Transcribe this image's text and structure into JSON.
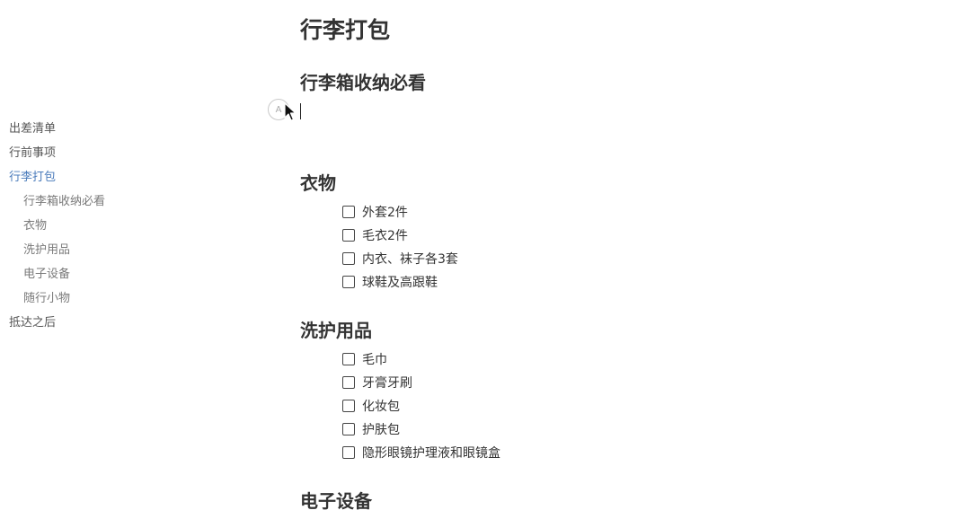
{
  "outline": {
    "items": [
      {
        "label": "出差清单"
      },
      {
        "label": "行前事项"
      },
      {
        "label": "行李打包"
      },
      {
        "label": "行李箱收纳必看"
      },
      {
        "label": "衣物"
      },
      {
        "label": "洗护用品"
      },
      {
        "label": "电子设备"
      },
      {
        "label": "随行小物"
      },
      {
        "label": "抵达之后"
      }
    ],
    "active_color": "#4a7bbb"
  },
  "editor": {
    "title": "行李打包",
    "subtitle": "行李箱收纳必看",
    "handle_label": "A",
    "sections": [
      {
        "heading": "衣物",
        "tasks": [
          "外套2件",
          "毛衣2件",
          "内衣、袜子各3套",
          "球鞋及高跟鞋"
        ]
      },
      {
        "heading": "洗护用品",
        "tasks": [
          "毛巾",
          "牙膏牙刷",
          "化妆包",
          "护肤包",
          "隐形眼镜护理液和眼镜盒"
        ]
      },
      {
        "heading": "电子设备",
        "tasks": []
      }
    ]
  },
  "icons": {
    "cursor": "mouse-pointer-icon",
    "handle": "block-type-handle-icon",
    "checkbox": "checkbox-unchecked-icon"
  }
}
